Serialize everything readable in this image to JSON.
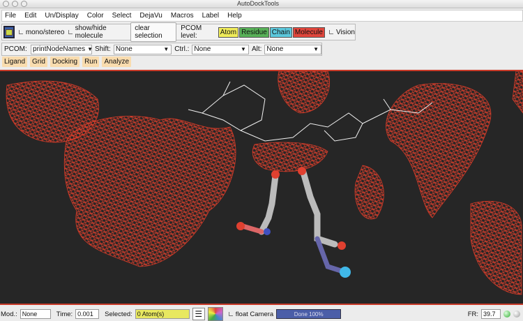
{
  "window": {
    "title": "AutoDockTools"
  },
  "menu": [
    "File",
    "Edit",
    "Un/Display",
    "Color",
    "Select",
    "DejaVu",
    "Macros",
    "Label",
    "Help"
  ],
  "toolbar": {
    "mono_stereo": "mono/stereo",
    "show_hide": "show/hide molecule",
    "clear_selection": "clear selection",
    "pcom_level_label": "PCOM level:",
    "levels": [
      {
        "label": "Atom",
        "color": "#f0ec5a"
      },
      {
        "label": "Residue",
        "color": "#58b158"
      },
      {
        "label": "Chain",
        "color": "#5cc8dc"
      },
      {
        "label": "Molecule",
        "color": "#e0463c"
      }
    ],
    "vision": "Vision"
  },
  "pcom": {
    "label": "PCOM:",
    "value": "printNodeNames",
    "shift_label": "Shift:",
    "shift_value": "None",
    "ctrl_label": "Ctrl.:",
    "ctrl_value": "None",
    "alt_label": "Alt:",
    "alt_value": "None"
  },
  "tabs": [
    "Ligand",
    "Grid",
    "Docking",
    "Run",
    "Analyze"
  ],
  "status": {
    "mod_label": "Mod.:",
    "mod_value": "None",
    "time_label": "Time:",
    "time_value": "0.001",
    "selected_label": "Selected:",
    "selected_value": "0 Atom(s)",
    "float_camera": "float Camera",
    "progress_text": "Done 100%",
    "progress": 100,
    "fr_label": "FR:",
    "fr_value": "39.7"
  }
}
